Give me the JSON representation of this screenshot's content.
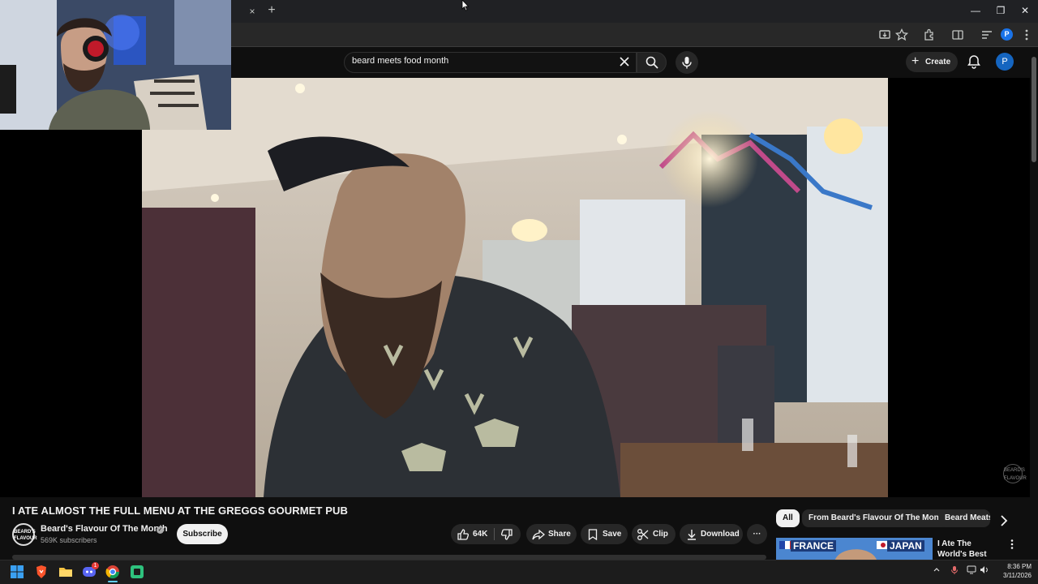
{
  "browser": {
    "close_tab_glyph": "×",
    "new_tab_glyph": "+",
    "window_controls": [
      "—",
      "❐",
      "✕"
    ]
  },
  "header": {
    "search_value": "beard meets food month",
    "create_label": "Create",
    "avatar_letter": "P",
    "profile_letter": "P"
  },
  "video": {
    "title": "I ATE ALMOST THE FULL MENU AT THE GREGGS GOURMET PUB",
    "watermark_text": "BEARD'S FLAVOUR"
  },
  "channel": {
    "name": "Beard's Flavour Of The Month",
    "subscribers": "569K subscribers",
    "subscribe_label": "Subscribe",
    "avatar_text": "BEARD'S FLAVOUR"
  },
  "actions": {
    "like_count": "64K",
    "share_label": "Share",
    "save_label": "Save",
    "clip_label": "Clip",
    "download_label": "Download",
    "more_glyph": "···"
  },
  "chips": [
    "All",
    "From Beard's Flavour Of The Month",
    "Beard Meats"
  ],
  "recommendation": {
    "thumb_left": "FRANCE",
    "thumb_right": "JAPAN",
    "title": "I Ate The World's Best Sandwich"
  },
  "taskbar": {
    "discord_badge": "1",
    "time": "8:36 PM",
    "date": "3/11/2026"
  },
  "colors": {
    "bg": "#0f0f0f",
    "chip_active": "#f1f1f1",
    "avatar_blue": "#1565c0"
  },
  "icons": [
    "search-icon",
    "clear-icon",
    "mic-icon",
    "bell-icon",
    "like-icon",
    "dislike-icon",
    "share-icon",
    "save-icon",
    "clip-icon",
    "download-icon",
    "more-icon",
    "chevron-right-icon"
  ]
}
